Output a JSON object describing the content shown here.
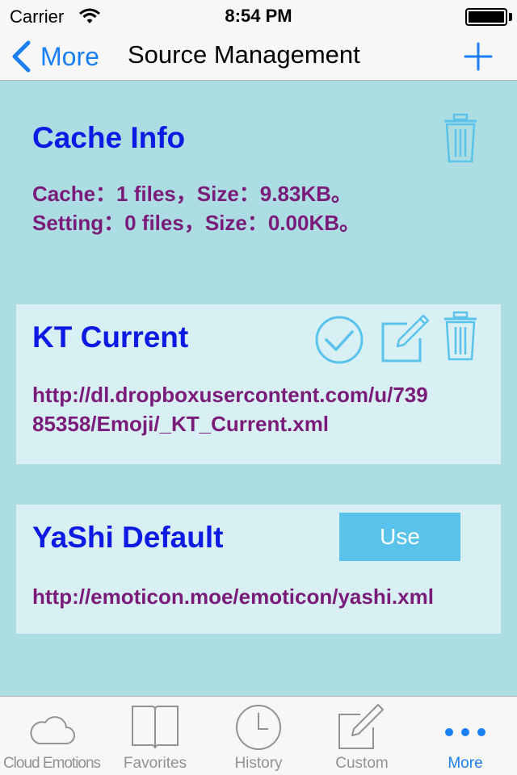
{
  "status_bar": {
    "carrier": "Carrier",
    "time": "8:54 PM"
  },
  "nav": {
    "back_label": "More",
    "title": "Source Management"
  },
  "cache": {
    "title": "Cache Info",
    "line1": "Cache：1 files，Size：9.83KB。",
    "line2": "Setting：0 files，Size：0.00KB。"
  },
  "sources": [
    {
      "name": "KT Current",
      "url_line1": "http://dl.dropboxusercontent.com/u/739",
      "url_line2": "85358/Emoji/_KT_Current.xml"
    },
    {
      "name": "YaShi Default",
      "url": "http://emoticon.moe/emoticon/yashi.xml",
      "use_label": "Use"
    }
  ],
  "tabs": [
    {
      "label": "Cloud Emotions",
      "icon": "cloud-icon"
    },
    {
      "label": "Favorites",
      "icon": "book-icon"
    },
    {
      "label": "History",
      "icon": "clock-icon"
    },
    {
      "label": "Custom",
      "icon": "edit-icon"
    },
    {
      "label": "More",
      "icon": "more-icon",
      "active": true
    }
  ],
  "colors": {
    "accent": "#1a7ef5",
    "icon": "#5ac3eb",
    "title": "#0d1ae4",
    "text": "#7a1b79",
    "background": "#acdde3",
    "card": "#d8f0f4"
  }
}
